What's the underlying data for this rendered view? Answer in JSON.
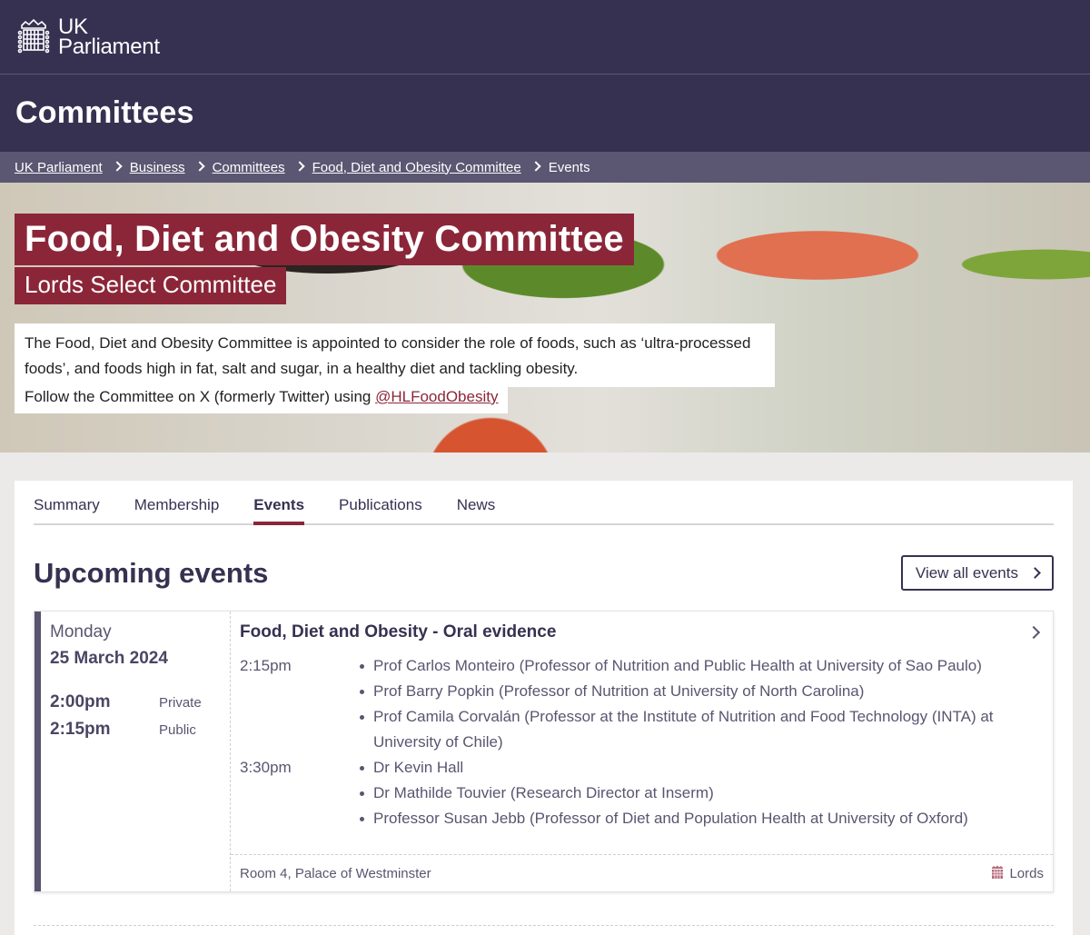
{
  "site": {
    "logo_line1": "UK",
    "logo_line2": "Parliament",
    "section_title": "Committees"
  },
  "breadcrumb": {
    "items": [
      "UK Parliament",
      "Business",
      "Committees",
      "Food, Diet and Obesity Committee"
    ],
    "current": "Events"
  },
  "hero": {
    "title": "Food, Diet and Obesity Committee",
    "subtitle": "Lords Select Committee",
    "description": "The Food, Diet and Obesity Committee is appointed to consider the role of foods, such as ‘ultra-processed foods’, and foods high in fat, salt and sugar, in a healthy diet and tackling obesity.",
    "follow_text": "Follow the Committee on X (formerly Twitter) using ",
    "follow_handle": "@HLFoodObesity"
  },
  "tabs": [
    {
      "label": "Summary",
      "active": false
    },
    {
      "label": "Membership",
      "active": false
    },
    {
      "label": "Events",
      "active": true
    },
    {
      "label": "Publications",
      "active": false
    },
    {
      "label": "News",
      "active": false
    }
  ],
  "upcoming": {
    "heading": "Upcoming events",
    "view_all_label": "View all events"
  },
  "event": {
    "day": "Monday",
    "date": "25 March 2024",
    "times": [
      {
        "time": "2:00pm",
        "status": "Private"
      },
      {
        "time": "2:15pm",
        "status": "Public"
      }
    ],
    "title": "Food, Diet and Obesity - Oral evidence",
    "sessions": [
      {
        "time": "2:15pm",
        "witnesses": [
          "Prof Carlos Monteiro (Professor of Nutrition and Public Health at University of Sao Paulo)",
          "Prof Barry Popkin (Professor of Nutrition at University of North Carolina)",
          "Prof Camila Corvalán (Professor at the Institute of Nutrition and Food Technology (INTA) at University of Chile)"
        ]
      },
      {
        "time": "3:30pm",
        "witnesses": [
          "Dr Kevin Hall",
          "Dr Mathilde Touvier (Research Director at Inserm)",
          "Professor Susan Jebb (Professor of Diet and Population Health at University of Oxford)"
        ]
      }
    ],
    "location": "Room 4, Palace of Westminster",
    "house": "Lords",
    "house_color": "#b5697a"
  },
  "colors": {
    "brand_dark": "#373151",
    "lords_red": "#8b2639"
  }
}
